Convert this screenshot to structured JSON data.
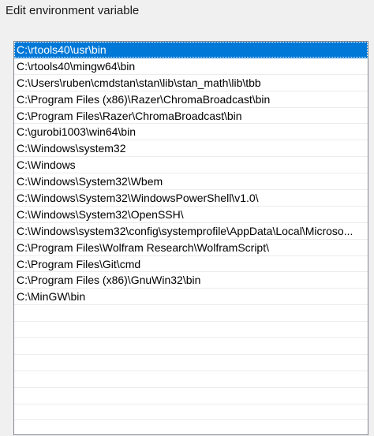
{
  "dialog": {
    "title": "Edit environment variable"
  },
  "list": {
    "selected_index": 0,
    "items": [
      "C:\\rtools40\\usr\\bin",
      "C:\\rtools40\\mingw64\\bin",
      "C:\\Users\\ruben\\cmdstan\\stan\\lib\\stan_math\\lib\\tbb",
      "C:\\Program Files (x86)\\Razer\\ChromaBroadcast\\bin",
      "C:\\Program Files\\Razer\\ChromaBroadcast\\bin",
      "C:\\gurobi1003\\win64\\bin",
      "C:\\Windows\\system32",
      "C:\\Windows",
      "C:\\Windows\\System32\\Wbem",
      "C:\\Windows\\System32\\WindowsPowerShell\\v1.0\\",
      "C:\\Windows\\System32\\OpenSSH\\",
      "C:\\Windows\\system32\\config\\systemprofile\\AppData\\Local\\Microso...",
      "C:\\Program Files\\Wolfram Research\\WolframScript\\",
      "C:\\Program Files\\Git\\cmd",
      "C:\\Program Files (x86)\\GnuWin32\\bin",
      "C:\\MinGW\\bin"
    ]
  },
  "colors": {
    "selection": "#0078d7",
    "window_background": "#f0f0f0",
    "list_background": "#ffffff"
  }
}
